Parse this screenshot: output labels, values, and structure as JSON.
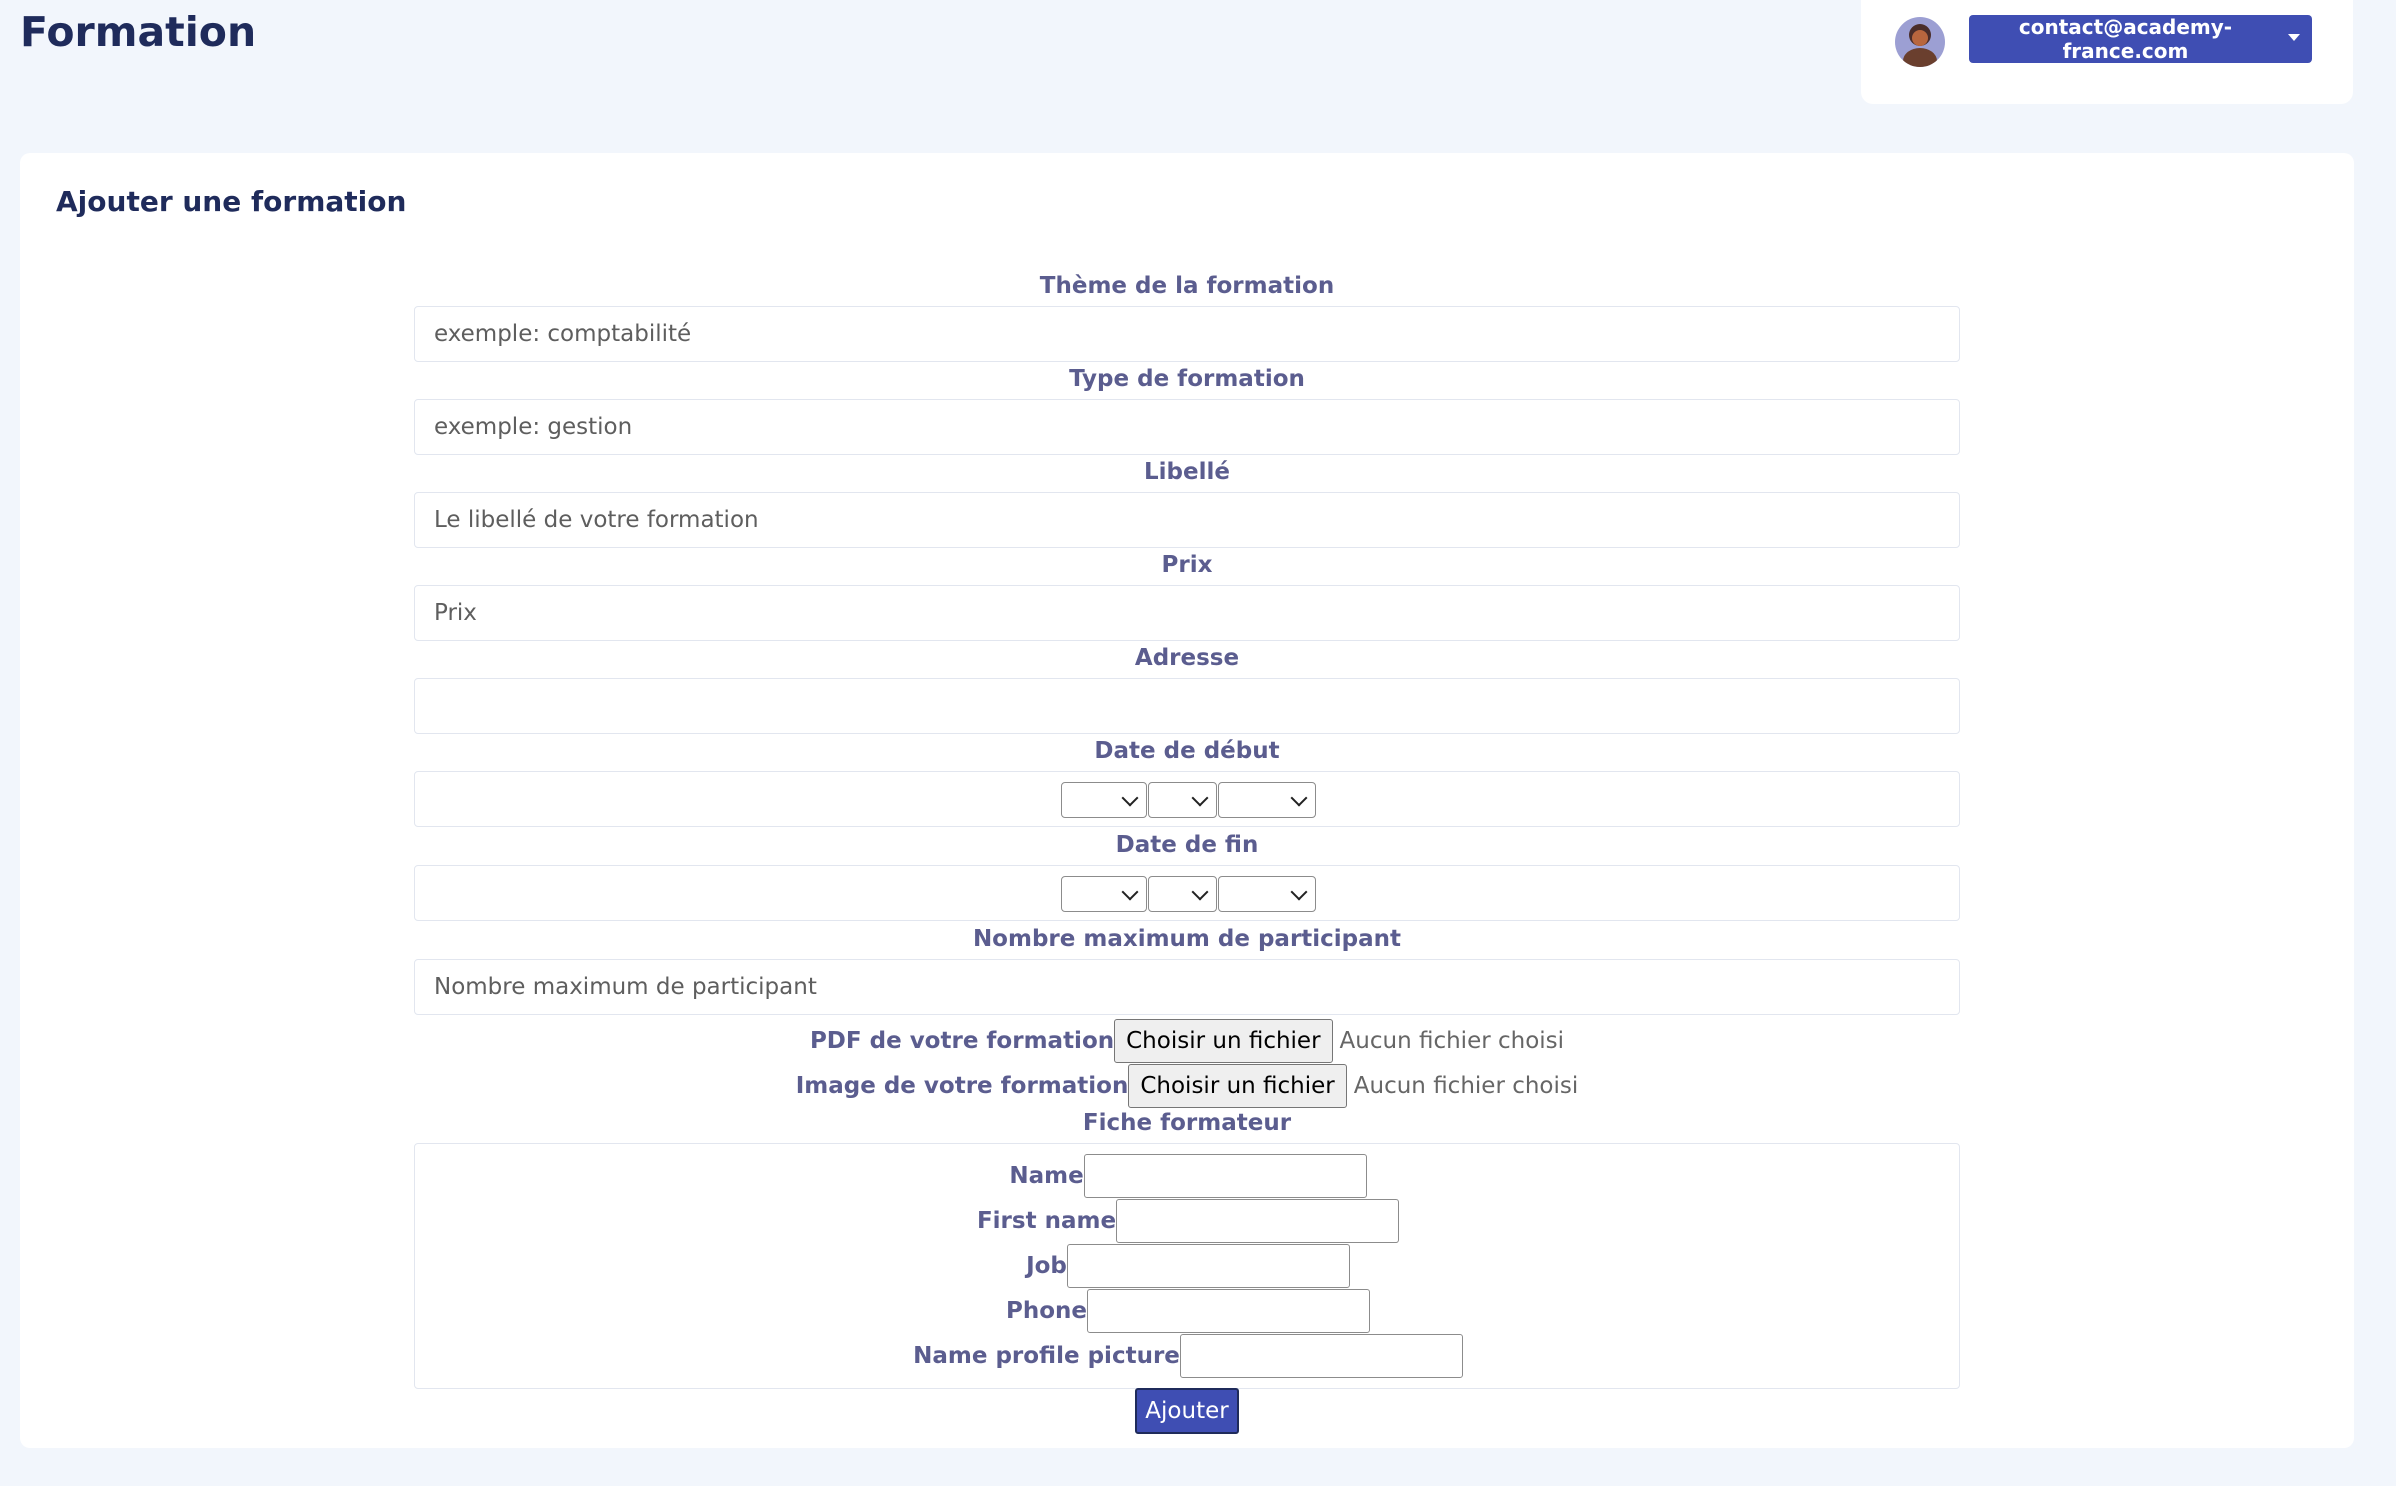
{
  "page": {
    "title": "Formation"
  },
  "user": {
    "email": "contact@academy-france.com",
    "avatar_icon": "user-avatar"
  },
  "form": {
    "title": "Ajouter une formation",
    "theme": {
      "label": "Thème de la formation",
      "placeholder": "exemple: comptabilité",
      "value": ""
    },
    "type": {
      "label": "Type de formation",
      "placeholder": "exemple: gestion",
      "value": ""
    },
    "libelle": {
      "label": "Libellé",
      "placeholder": "Le libellé de votre formation",
      "value": ""
    },
    "prix": {
      "label": "Prix",
      "placeholder": "Prix",
      "value": ""
    },
    "adresse": {
      "label": "Adresse",
      "placeholder": "",
      "value": ""
    },
    "date_debut": {
      "label": "Date de début",
      "day": "",
      "month": "",
      "year": ""
    },
    "date_fin": {
      "label": "Date de fin",
      "day": "",
      "month": "",
      "year": ""
    },
    "max_participants": {
      "label": "Nombre maximum de participant",
      "placeholder": "Nombre maximum de participant",
      "value": ""
    },
    "pdf": {
      "label": "PDF de votre formation",
      "button": "Choisir un fichier",
      "status": "Aucun fichier choisi"
    },
    "image": {
      "label": "Image de votre formation",
      "button": "Choisir un fichier",
      "status": "Aucun fichier choisi"
    },
    "trainer": {
      "label": "Fiche formateur",
      "name": {
        "label": "Name",
        "value": ""
      },
      "first_name": {
        "label": "First name",
        "value": ""
      },
      "job": {
        "label": "Job",
        "value": ""
      },
      "phone": {
        "label": "Phone",
        "value": ""
      },
      "profile_picture": {
        "label": "Name profile picture",
        "value": ""
      }
    },
    "submit": "Ajouter"
  },
  "colors": {
    "accent": "#3f4eb3",
    "title": "#1f2b5b",
    "label": "#5b5d8f",
    "background": "#f2f6fc"
  }
}
